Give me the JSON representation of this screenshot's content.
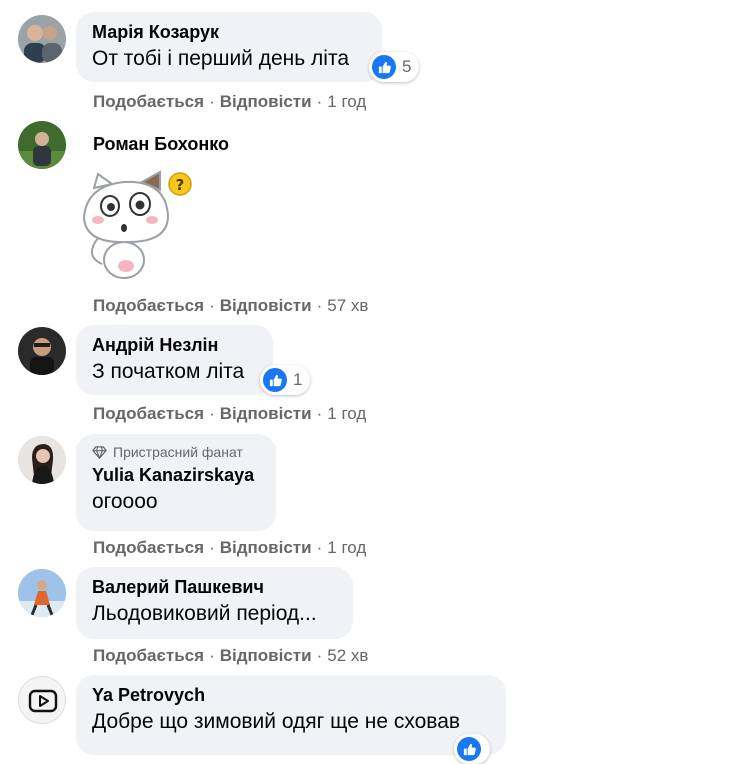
{
  "actions": {
    "like": "Подобається",
    "reply": "Відповісти",
    "sep": "·"
  },
  "comments": [
    {
      "author": "Марія Козарук",
      "text": "От тобі і перший день літа",
      "reactions": "5",
      "time": "1 год"
    },
    {
      "author": "Роман Бохонко",
      "text": "",
      "sticker": "confused-cat-sticker",
      "time": "57 хв"
    },
    {
      "author": "Андрій Незлін",
      "text": "З початком літа",
      "reactions": "1",
      "time": "1 год"
    },
    {
      "author": "Yulia Kanazirskaya",
      "badge": "Пристрасний фанат",
      "text": "огоооо",
      "time": "1 год"
    },
    {
      "author": "Валерий Пашкевич",
      "text": "Льодовиковий період...",
      "time": "52 хв"
    },
    {
      "author": "Ya Petrovych",
      "text": "Добре що зимовий одяг ще не сховав"
    }
  ],
  "colors": {
    "bubble": "#f0f2f5",
    "meta": "#65676b",
    "like": "#1877f2",
    "text": "#050505"
  }
}
